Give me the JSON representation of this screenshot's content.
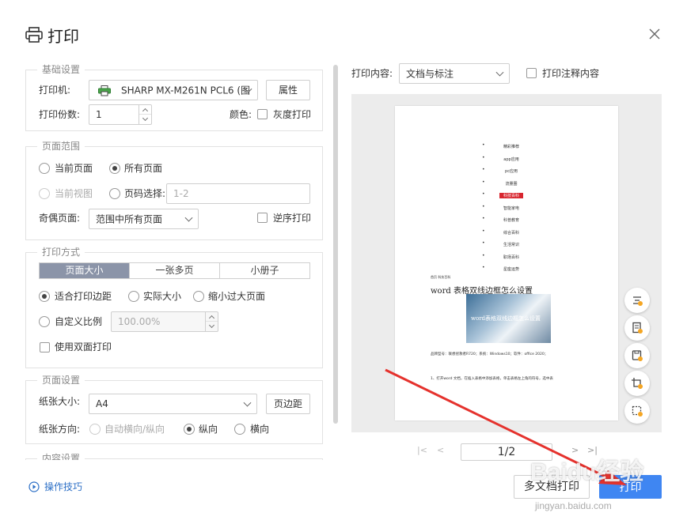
{
  "window": {
    "title": "打印"
  },
  "basic": {
    "legend": "基础设置",
    "printer_label": "打印机:",
    "printer_value": "SHARP MX-M261N PCL6 (图",
    "properties_button": "属性",
    "copies_label": "打印份数:",
    "copies_value": "1",
    "color_label": "颜色:",
    "grayscale_label": "灰度打印"
  },
  "range": {
    "legend": "页面范围",
    "current_page": "当前页面",
    "all_pages": "所有页面",
    "current_view": "当前视图",
    "page_select": "页码选择:",
    "page_select_placeholder": "1-2",
    "odd_even_label": "奇偶页面:",
    "odd_even_value": "范围中所有页面",
    "reverse_label": "逆序打印"
  },
  "mode": {
    "legend": "打印方式",
    "tabs": [
      "页面大小",
      "一张多页",
      "小册子"
    ],
    "fit_margin": "适合打印边距",
    "actual_size": "实际大小",
    "shrink_large": "缩小过大页面",
    "custom_scale": "自定义比例",
    "scale_value": "100.00%",
    "duplex_label": "使用双面打印"
  },
  "page_setup": {
    "legend": "页面设置",
    "paper_size_label": "纸张大小:",
    "paper_size_value": "A4",
    "margins_button": "页边距",
    "orientation_label": "纸张方向:",
    "auto_orient": "自动横向/纵向",
    "portrait": "纵向",
    "landscape": "横向"
  },
  "content_settings": {
    "legend": "内容设置"
  },
  "preview_options": {
    "content_label": "打印内容:",
    "content_value": "文档与标注",
    "annotations_label": "打印注释内容"
  },
  "preview_doc": {
    "bullets": [
      "精彩推荐",
      "app应用",
      "pc应用",
      "流量圈",
      "科技百科",
      "智能家电",
      "科普教育",
      "综合百科",
      "生活常识",
      "职场百科",
      "星座运势"
    ],
    "category": "首页 科技百科",
    "title": "word 表格双线边框怎么设置",
    "image_caption": "word表格双线边框怎么设置",
    "line1": "品牌型号：联想拯救者R720；系统：Windows10；软件：office 2020；",
    "line2": "1、打开word 文档，在插入表格中添加表格，单击表格左上角的符号，选中表"
  },
  "pager": {
    "page_text": "1/2"
  },
  "footer": {
    "help_link": "操作技巧",
    "multi_doc_button": "多文档打印",
    "print_button": "打印"
  },
  "watermark": {
    "logo": "Baidu经验",
    "url": "jingyan.baidu.com"
  },
  "colors": {
    "primary": "#3f86f2",
    "tab_active": "#8b94a8",
    "arrow": "#e5322d",
    "link": "#2c6fc6"
  }
}
